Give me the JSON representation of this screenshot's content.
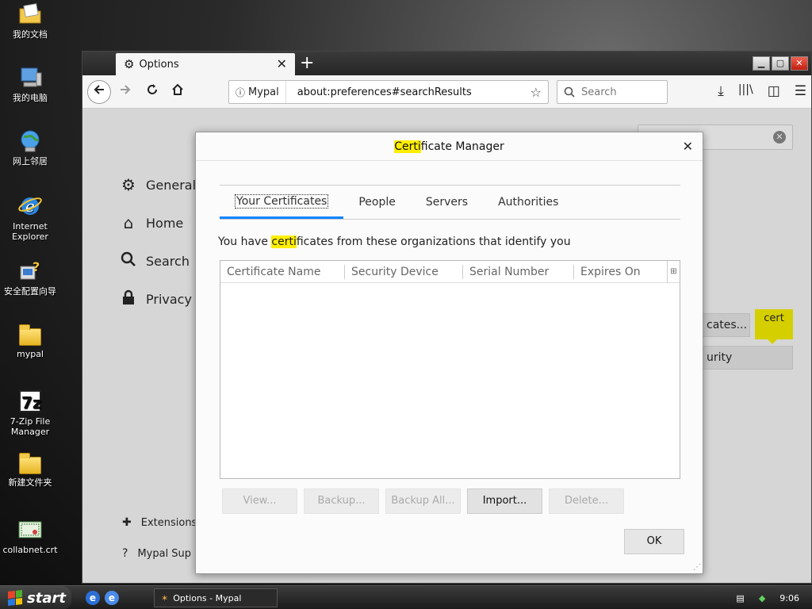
{
  "desktop": {
    "icons": [
      {
        "label": "我的文档"
      },
      {
        "label": "我的电脑"
      },
      {
        "label": "网上邻居"
      },
      {
        "label": "Internet Explorer"
      },
      {
        "label": "安全配置向导"
      },
      {
        "label": "mypal"
      },
      {
        "label": "7-Zip File Manager"
      },
      {
        "label": "新建文件夹"
      },
      {
        "label": "collabnet.crt"
      }
    ]
  },
  "browser": {
    "tab_title": "Options",
    "tab_close": "✕",
    "new_tab": "+",
    "identity_label": "Mypal",
    "url": "about:preferences#searchResults",
    "search_placeholder": "Search"
  },
  "prefs": {
    "sidebar": [
      {
        "label": "General",
        "icon": "gear-icon"
      },
      {
        "label": "Home",
        "icon": "home-icon"
      },
      {
        "label": "Search",
        "icon": "search-icon"
      },
      {
        "label": "Privacy &",
        "icon": "lock-icon"
      }
    ],
    "footer": [
      {
        "label": "Extensions",
        "icon": "puzzle-icon"
      },
      {
        "label": "Mypal Sup",
        "icon": "help-icon"
      }
    ],
    "bg_buttons": [
      "cates...",
      "urity Devices..."
    ],
    "tooltip": "cert"
  },
  "dialog": {
    "title_highlight": "Certi",
    "title_rest": "ficate Manager",
    "tabs": [
      "Your Certificates",
      "People",
      "Servers",
      "Authorities"
    ],
    "desc_before": "You have ",
    "desc_highlight": "certi",
    "desc_after": "ficates from these organizations that identify you",
    "columns": [
      "Certificate Name",
      "Security Device",
      "Serial Number",
      "Expires On"
    ],
    "buttons": [
      {
        "label": "View...",
        "enabled": false
      },
      {
        "label": "Backup...",
        "enabled": false
      },
      {
        "label": "Backup All...",
        "enabled": false
      },
      {
        "label": "Import...",
        "enabled": true
      },
      {
        "label": "Delete...",
        "enabled": false
      }
    ],
    "ok_label": "OK"
  },
  "taskbar": {
    "start_label": "start",
    "task_label": "Options - Mypal",
    "clock": "9:06"
  }
}
